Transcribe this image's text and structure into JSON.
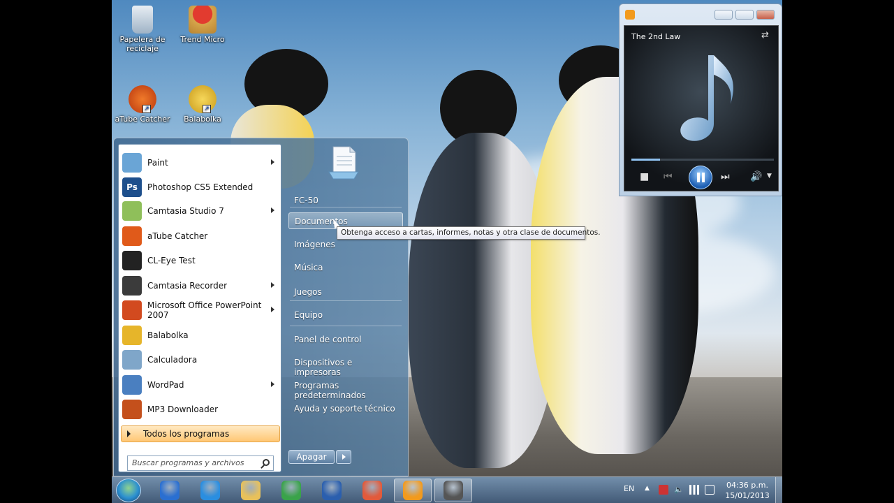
{
  "desktop": {
    "icons": [
      {
        "label": "Papelera de reciclaje",
        "icon": "recycle-bin-icon"
      },
      {
        "label": "Trend Micro",
        "icon": "trend-micro-icon"
      },
      {
        "label": "aTube Catcher",
        "icon": "atube-catcher-icon"
      },
      {
        "label": "Balabolka",
        "icon": "balabolka-icon"
      }
    ]
  },
  "start_menu": {
    "programs": [
      {
        "label": "Paint",
        "submenu": true,
        "color": "#6aa5d6"
      },
      {
        "label": "Photoshop CS5 Extended",
        "submenu": false,
        "color": "#1d4f8c",
        "glyph": "Ps"
      },
      {
        "label": "Camtasia Studio 7",
        "submenu": true,
        "color": "#8fbf5a"
      },
      {
        "label": "aTube Catcher",
        "submenu": false,
        "color": "#e05a1a"
      },
      {
        "label": "CL-Eye Test",
        "submenu": false,
        "color": "#222222"
      },
      {
        "label": "Camtasia Recorder",
        "submenu": true,
        "color": "#3b3b3b"
      },
      {
        "label": "Microsoft Office PowerPoint 2007",
        "submenu": true,
        "color": "#d24a1f"
      },
      {
        "label": "Balabolka",
        "submenu": false,
        "color": "#e6b52a"
      },
      {
        "label": "Calculadora",
        "submenu": false,
        "color": "#7fa6c9"
      },
      {
        "label": "WordPad",
        "submenu": true,
        "color": "#4a7fc0"
      },
      {
        "label": "MP3 Downloader",
        "submenu": false,
        "color": "#c4501c"
      }
    ],
    "all_programs": "Todos los programas",
    "search_placeholder": "Buscar programas y archivos",
    "right_items": [
      {
        "label": "FC-50"
      },
      {
        "label": "Documentos"
      },
      {
        "label": "Imágenes"
      },
      {
        "label": "Música"
      },
      {
        "label": "Juegos"
      },
      {
        "label": "Equipo"
      },
      {
        "label": "Panel de control"
      },
      {
        "label": "Dispositivos e impresoras"
      },
      {
        "label": "Programas predeterminados"
      },
      {
        "label": "Ayuda y soporte técnico"
      }
    ],
    "highlighted_item": "Documentos",
    "shutdown_label": "Apagar",
    "tooltip": "Obtenga acceso a cartas, informes, notas y otra clase de documentos."
  },
  "media_player": {
    "now_playing": "The 2nd Law",
    "progress": 0.2
  },
  "taskbar": {
    "pinned": [
      {
        "name": "itunes",
        "color": "#2a6fd1",
        "active": false
      },
      {
        "name": "internet-explorer",
        "color": "#2a8ee0",
        "active": false
      },
      {
        "name": "explorer",
        "color": "#e8c15a",
        "active": false
      },
      {
        "name": "chrome",
        "color": "#3aa34a",
        "active": false
      },
      {
        "name": "word",
        "color": "#2b5fae",
        "active": false
      },
      {
        "name": "pinwheel",
        "color": "#e25a3b",
        "active": false
      },
      {
        "name": "media-player",
        "color": "#f29a1d",
        "active": true
      },
      {
        "name": "camtasia-recorder",
        "color": "#555555",
        "active": true
      }
    ],
    "language": "EN",
    "time": "04:36 p.m.",
    "date": "15/01/2013"
  },
  "colors": {
    "accent": "#2b6cb0",
    "highlight_orange": "#ffc774"
  }
}
